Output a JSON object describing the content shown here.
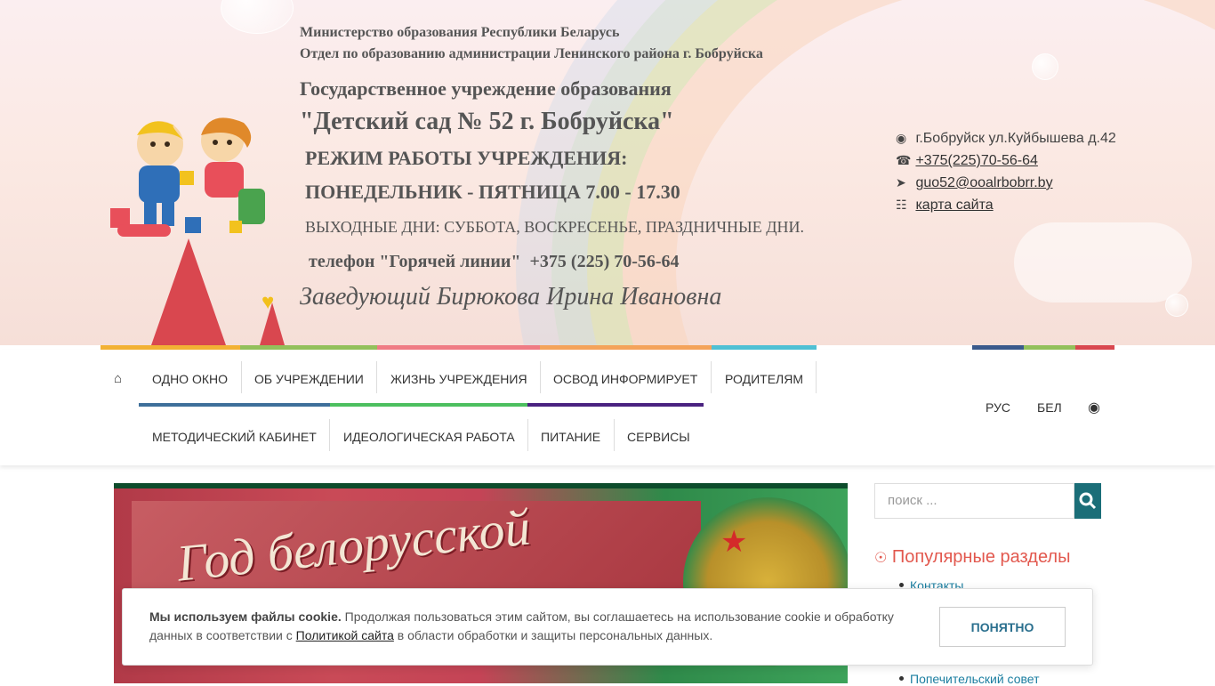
{
  "header": {
    "ministry": "Министерство образования Республики Беларусь",
    "department": "Отдел по образованию администрации Ленинского района г. Бобруйска",
    "institution_type": "Государственное учреждение образования",
    "institution_name": "\"Детский сад № 52 г. Бобруйска\"",
    "hours_title": "РЕЖИМ РАБОТЫ УЧРЕЖДЕНИЯ:",
    "hours": "ПОНЕДЕЛЬНИК - ПЯТНИЦА 7.00 - 17.30",
    "days_off": "ВЫХОДНЫЕ ДНИ: СУББОТА, ВОСКРЕСЕНЬЕ, ПРАЗДНИЧНЫЕ ДНИ.",
    "hotline": "телефон \"Горячей линии\"  +375 (225) 70-56-64",
    "director": "Заведующий Бирюкова Ирина Ивановна"
  },
  "contacts": {
    "address": "г.Бобруйск ул.Куйбышева д.42",
    "phone": "+375(225)70-56-64",
    "email": "guo52@ooalrbobrr.by",
    "sitemap": "карта сайта",
    "icons": [
      "map-marker-icon",
      "phone-icon",
      "paper-plane-icon",
      "sitemap-icon"
    ]
  },
  "nav": {
    "home_icon": "home-icon",
    "row1": [
      "ОДНО ОКНО",
      "ОБ УЧРЕЖДЕНИИ",
      "ЖИЗНЬ УЧРЕЖДЕНИЯ",
      "ОСВОД ИНФОРМИРУЕТ",
      "РОДИТЕЛЯМ"
    ],
    "row2": [
      "МЕТОДИЧЕСКИЙ КАБИНЕТ",
      "ИДЕОЛОГИЧЕСКАЯ РАБОТА",
      "ПИТАНИЕ",
      "СЕРВИСЫ"
    ],
    "lang_ru": "РУС",
    "lang_by": "БЕЛ",
    "accessibility_icon": "eye-icon",
    "bar_colors": [
      "#f2b134",
      "#93c05b",
      "#ef7b84",
      "#f4a35a",
      "#4fc0d4",
      "#3a5a8c",
      "#93c05b",
      "#d9474f"
    ]
  },
  "banner": {
    "title": "Год белорусской"
  },
  "sidebar": {
    "search_placeholder": "поиск ...",
    "popular_title": "Популярные разделы",
    "links": [
      "Контакты",
      "Попечительский совет"
    ]
  },
  "cookie": {
    "bold": "Мы используем файлы cookie.",
    "text1": " Продолжая пользоваться этим сайтом, вы соглашаетесь на использование cookie и обработку данных в соответствии с ",
    "link": "Политикой сайта",
    "text2": " в области обработки и защиты персональных данных.",
    "button": "ПОНЯТНО"
  }
}
